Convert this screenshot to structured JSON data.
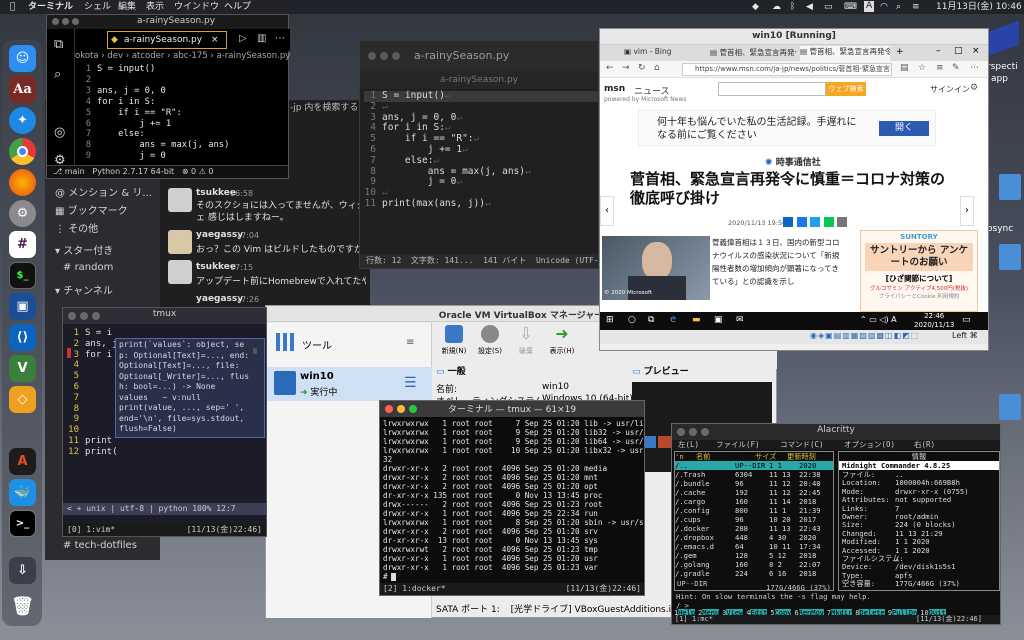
{
  "menubar": {
    "app_name": "ターミナル",
    "items": [
      "シェル",
      "編集",
      "表示",
      "ウインドウ",
      "ヘルプ"
    ],
    "ime": "A",
    "datetime": "11月13日(金) 10:46"
  },
  "slack": {
    "sidebar": {
      "items": [
        "メンション & リ...",
        "ブックマーク",
        "その他"
      ],
      "starred_header": "スター付き",
      "starred": [
        "random"
      ],
      "channels_header": "チャンネル",
      "channels": [
        "tech-dotfiles"
      ]
    },
    "search_placeholder": "-jp 内を検索する",
    "messages": [
      {
        "user": "tsukkee",
        "time": "16:58",
        "text": "そのスクショには入ってませんが、ウィジェ 感じはしますねー。"
      },
      {
        "user": "yaegassy",
        "time": "17:04",
        "text": "おっ？この Vim はビルドしたものですか？"
      },
      {
        "user": "tsukkee",
        "time": "17:15",
        "text": "アップデート前にHomebrewで入れてたやつがそのまま動きましたー"
      },
      {
        "user": "yaegassy",
        "time": "17:26",
        "text": ""
      }
    ]
  },
  "vscode": {
    "title": "a-rainySeason.py",
    "tab": "a-rainySeason.py",
    "breadcrumb": "okota › dev › atcoder › abc-175 › a-rainySeason.py",
    "lines": [
      "S = input()",
      "",
      "ans, j = 0, 0",
      "for i in S:",
      "    if i == \"R\":",
      "        j += 1",
      "    else:",
      "        ans = max(j, ans)",
      "        j = 0"
    ],
    "status": {
      "branch": "main",
      "python": "Python 2.7.17 64-bit",
      "problems": "⊗ 0 ⚠ 0"
    }
  },
  "text_editor": {
    "title": "a-rainySeason.py",
    "subtitle": "a-rainySeason.py",
    "lines": [
      "S = input()",
      "",
      "ans, j = 0, 0",
      "for i in S:",
      "    if i == \"R\":",
      "        j += 1",
      "    else:",
      "        ans = max(j, ans)",
      "        j = 0",
      "",
      "print(max(ans, j))"
    ],
    "status": [
      "行数: 12",
      "文字数: 141...",
      "141 バイト",
      "Unicode (UTF-8)",
      "LF"
    ]
  },
  "vm": {
    "title": "win10 [Running]",
    "tabs": [
      "vim - Bing",
      "菅首相、緊急宣言再発令",
      "菅首相、緊急宣言再発令に"
    ],
    "address": "https://www.msn.com/ja-jp/news/politics/菅首相-緊急宣言再発令に慎",
    "msn": {
      "logo": "msn",
      "nav": "ニュース",
      "powered": "powered by Microsoft News",
      "search_button": "ウェブ検索",
      "signin": "サインイン",
      "ad_text": "何十年も悩んでいた私の生活記録。手遅れになる前にご覧ください",
      "ad_button": "開く",
      "source": "時事通信社",
      "headline": "菅首相、緊急宣言再発令に慎重＝コロナ対策の徹底呼び掛け",
      "date": "2020/11/13 19:50",
      "body": "菅義偉首相は１３日、国内の新型コロナウイルスの感染状況について「新規陽性者数の増加傾向が顕著になってきている」との認識を示し",
      "photo_credit": "© 2020 Microsoft",
      "side_brand": "SUNTORY",
      "side_title": "サントリーから アンケートのお願い",
      "side_sub": "[ひざ関節について]",
      "side_note": "グルコサミン アクティブ4,500円(税抜)",
      "side_footer": "プライバシーとCookie  利用規約"
    },
    "taskbar_time": "22:46",
    "taskbar_date": "2020/11/13",
    "status_right": "Left ⌘"
  },
  "desktop_icons": [
    "rspecti",
    "app",
    "osync"
  ],
  "vbox": {
    "title": "Oracle VM VirtualBox マネージャー",
    "toolbar_label": "ツール",
    "buttons": [
      "新規(N)",
      "設定(S)",
      "破棄",
      "表示(H)"
    ],
    "vm_name": "win10",
    "vm_state": "実行中",
    "general_header": "一般",
    "preview_header": "プレビュー",
    "details": [
      [
        "名前:",
        "win10"
      ],
      [
        "オペレーティングシステム:",
        "Windows 10 (64-bit)"
      ]
    ],
    "storage": [
      [
        "SATA ポート 1:",
        "[光学ドライブ] VBoxGuestAdditions.iso"
      ]
    ]
  },
  "tmux1": {
    "title": "tmux",
    "lines": [
      "S = i",
      "ans, j",
      "for i",
      "",
      "",
      "",
      "",
      "",
      "",
      "",
      "print",
      "print("
    ],
    "popup": [
      "print(`values`: object, se",
      "p: Optional[Text]=..., end:",
      "Optional[Text]=..., file:",
      "Optional[_Writer]=..., flus",
      "h: bool=...) -> None",
      "values   ~ v:null",
      "print(value, ..., sep=' ',",
      "end='\\n', file=sys.stdout,",
      "flush=False)"
    ],
    "status": "< +  unix | utf-8 | python  100%    12:7",
    "tmux_status": "[0] 1:vim*",
    "tmux_right": "[11/13(金)22:46]"
  },
  "term2": {
    "title": "ターミナル — tmux — 61×19",
    "lines": [
      "lrwxrwxrwx   1 root root     7 Sep 25 01:20 lib -> usr/lib",
      "lrwxrwxrwx   1 root root     9 Sep 25 01:20 lib32 -> usr/lib32",
      "lrwxrwxrwx   1 root root     9 Sep 25 01:20 lib64 -> usr/lib64",
      "lrwxrwxrwx   1 root root    10 Sep 25 01:20 libx32 -> usr/libx",
      "32",
      "drwxr-xr-x   2 root root  4096 Sep 25 01:20 media",
      "drwxr-xr-x   2 root root  4096 Sep 25 01:20 mnt",
      "drwxr-xr-x   2 root root  4096 Sep 25 01:20 opt",
      "dr-xr-xr-x 135 root root     0 Nov 13 13:45 proc",
      "drwx------   2 root root  4096 Sep 25 01:23 root",
      "drwxr-xr-x   1 root root  4096 Sep 25 22:34 run",
      "lrwxrwxrwx   1 root root     8 Sep 25 01:20 sbin -> usr/sbin",
      "drwxr-xr-x   2 root root  4096 Sep 25 01:20 srv",
      "dr-xr-xr-x  13 root root     0 Nov 13 13:45 sys",
      "drwxrwxrwt   2 root root  4096 Sep 25 01:23 tmp",
      "drwxr-xr-x   1 root root  4096 Sep 25 01:20 usr",
      "drwxr-xr-x   1 root root  4096 Sep 25 01:23 var",
      "#"
    ],
    "status": "[2] 1:docker*",
    "status_right": "[11/13(金)22:46]"
  },
  "alacritty": {
    "title": "Alacritty",
    "menu": [
      "左(L)",
      "ファイル(F)",
      "コマンド(C)",
      "オプション(O)",
      "右(R)"
    ],
    "left_header": [
      "'n",
      "名前",
      "サイズ",
      "更新時刻"
    ],
    "files": [
      [
        "/..",
        "UP--DIR",
        "1  1",
        "2020"
      ],
      [
        "/.Trash",
        "6304",
        "11 13",
        "22:38"
      ],
      [
        "/.bundle",
        "96",
        "11 12",
        "20:40"
      ],
      [
        "/.cache",
        "192",
        "11 12",
        "22:45"
      ],
      [
        "/.cargo",
        "160",
        "11 14",
        "2018"
      ],
      [
        "/.config",
        "800",
        "11  1",
        "21:39"
      ],
      [
        "/.cups",
        "96",
        "10 20",
        "2017"
      ],
      [
        "/.docker",
        "288",
        "11 13",
        "22:43"
      ],
      [
        "/.dropbox",
        "448",
        "4 30",
        "2020"
      ],
      [
        "/.emacs.d",
        "64",
        "10 11",
        "17:34"
      ],
      [
        "/.gem",
        "128",
        "5 12",
        "2018"
      ],
      [
        "/.golang",
        "160",
        "8  2",
        "22:07"
      ],
      [
        "/.gradle",
        "224",
        "6 16",
        "2018"
      ]
    ],
    "left_footer": "UP--DIR",
    "disk": "177G/466G (37%)",
    "right_title": "情報",
    "right_name": "Midnight Commander 4.8.25",
    "info": [
      [
        "ファイル:",
        ".."
      ],
      [
        "Location:",
        "1000004h:669B8h"
      ],
      [
        "Mode:",
        "drwxr-xr-x (0755)"
      ],
      [
        "Attributes:",
        "not supported"
      ],
      [
        "Links:",
        "7"
      ],
      [
        "Owner:",
        "root/admin"
      ],
      [
        "Size:",
        "224 (0 blocks)"
      ],
      [
        "Changed:",
        "11 13 21:29"
      ],
      [
        "Modified:",
        "1  1  2020"
      ],
      [
        "Accessed:",
        "1  1  2020"
      ],
      [
        "ファイルシステム:",
        "/"
      ],
      [
        "Device:",
        "/dev/disk1s5s1"
      ],
      [
        "Type:",
        "apfs"
      ],
      [
        "空き容量:",
        "177G/466G (37%)"
      ]
    ],
    "hint": "Hint: On slow terminals the -s flag may help.",
    "prompt": "/ >",
    "fkeys": [
      "1Help",
      "2Menu",
      "3View",
      "4Edit",
      "5Copy",
      "6RenMov",
      "7Mkdir",
      "8Delete",
      "9PullDn",
      "10Quit"
    ],
    "tmux_status": "[1] 1:mc*",
    "tmux_right": "[11/13(金)22:46]"
  }
}
